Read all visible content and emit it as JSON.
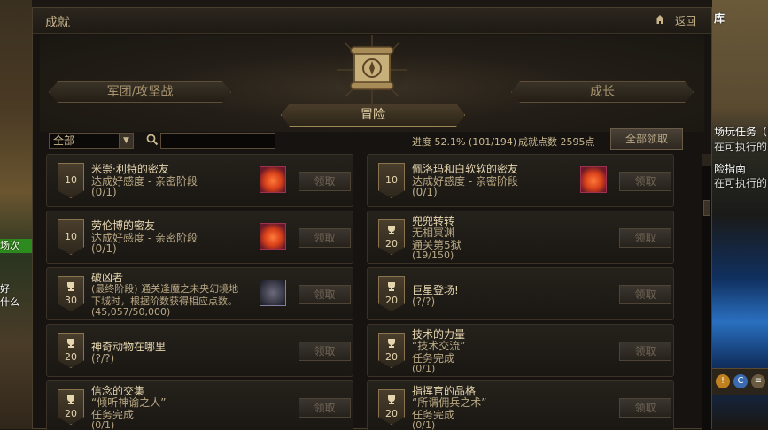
{
  "scene": {
    "left_lines": [
      "场次",
      "好",
      "什么"
    ],
    "right_lines": [
      "库",
      "场玩任务（限",
      "在可执行的",
      "险指南",
      "在可执行的"
    ]
  },
  "window": {
    "title": "成就",
    "back_label": "返回",
    "sub_back_label": "返回"
  },
  "tabs": {
    "left": "军团/攻坚战",
    "active": "冒险",
    "right": "成长"
  },
  "filter": {
    "selected": "全部",
    "search_value": "",
    "progress": "进度 52.1% (101/194)",
    "points": "成就点数 2595点",
    "claim_all": "全部领取"
  },
  "claim_label": "领取",
  "cards": [
    {
      "points": "10",
      "title": "米崇·利特的密友",
      "line2": "达成好感度 - 亲密阶段",
      "line3": "(0/1)",
      "line4": "",
      "reward": "heart-icon",
      "trophy": false
    },
    {
      "points": "10",
      "title": "佩洛玛和白软软的密友",
      "line2": "达成好感度 - 亲密阶段",
      "line3": "(0/1)",
      "line4": "",
      "reward": "heart-icon",
      "trophy": false
    },
    {
      "points": "10",
      "title": "劳伦博的密友",
      "line2": "达成好感度 - 亲密阶段",
      "line3": "(0/1)",
      "line4": "",
      "reward": "heart-icon",
      "trophy": false
    },
    {
      "points": "20",
      "title": "兜兜转转",
      "line2": "无相冥渊",
      "line3": "通关第5狱",
      "line4": "(19/150)",
      "reward": "",
      "trophy": true
    },
    {
      "points": "30",
      "title": "破凶者",
      "line2": "(最终阶段) 通关逢魔之未央幻境地",
      "line3": "下城时，根据阶数获得相应点数。",
      "line4": "(45,057/50,000)",
      "reward": "emblem-icon",
      "trophy": true
    },
    {
      "points": "20",
      "title": "巨星登场!",
      "line2": "(?/?)",
      "line3": "",
      "line4": "",
      "reward": "",
      "trophy": true
    },
    {
      "points": "20",
      "title": "神奇动物在哪里",
      "line2": "(?/?)",
      "line3": "",
      "line4": "",
      "reward": "",
      "trophy": true
    },
    {
      "points": "20",
      "title": "技术的力量",
      "line2": "“技术交流”",
      "line3": "任务完成",
      "line4": "(0/1)",
      "reward": "",
      "trophy": true
    },
    {
      "points": "20",
      "title": "信念的交集",
      "line2": "“倾听神谕之人”",
      "line3": "任务完成",
      "line4": "(0/1)",
      "reward": "",
      "trophy": true
    },
    {
      "points": "20",
      "title": "指挥官的品格",
      "line2": "“所谓佣兵之术”",
      "line3": "任务完成",
      "line4": "(0/1)",
      "reward": "",
      "trophy": true
    }
  ]
}
